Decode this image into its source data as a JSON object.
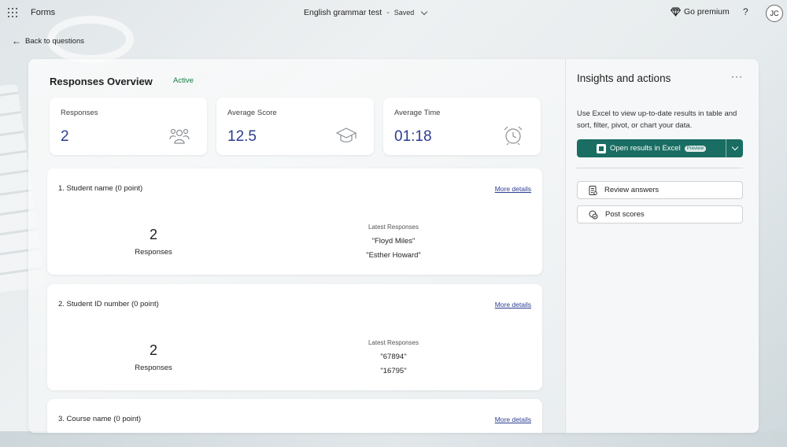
{
  "topbar": {
    "app_name": "Forms",
    "doc_title": "English grammar test",
    "separator": "-",
    "saved": "Saved",
    "premium": "Go premium",
    "help": "?",
    "avatar": "JC"
  },
  "back": {
    "label": "Back to questions"
  },
  "overview": {
    "title": "Responses Overview",
    "status": "Active",
    "stats": [
      {
        "label": "Responses",
        "value": "2",
        "icon": "people-icon"
      },
      {
        "label": "Average Score",
        "value": "12.5",
        "icon": "graduation-cap-icon"
      },
      {
        "label": "Average Time",
        "value": "01:18",
        "icon": "alarm-clock-icon"
      }
    ]
  },
  "questions": [
    {
      "title": "1. Student name (0 point)",
      "more": "More details",
      "count": "2",
      "count_label": "Responses",
      "latest_label": "Latest Responses",
      "responses": [
        "\"Floyd Miles\"",
        "\"Esther Howard\""
      ]
    },
    {
      "title": "2. Student ID number (0 point)",
      "more": "More details",
      "count": "2",
      "count_label": "Responses",
      "latest_label": "Latest Responses",
      "responses": [
        "\"67894\"",
        "\"16795\""
      ]
    },
    {
      "title": "3. Course name (0 point)",
      "more": "More details"
    }
  ],
  "insights": {
    "title": "Insights and actions",
    "more": "···",
    "description": "Use Excel to view up-to-date results in table and sort, filter, pivot, or chart your data.",
    "excel_label": "Open results in Excel",
    "preview_badge": "Preview",
    "review_label": "Review answers",
    "post_label": "Post scores"
  },
  "colors": {
    "accent": "#2b3d8f",
    "excel": "#1a6d62",
    "active": "#107c41"
  }
}
